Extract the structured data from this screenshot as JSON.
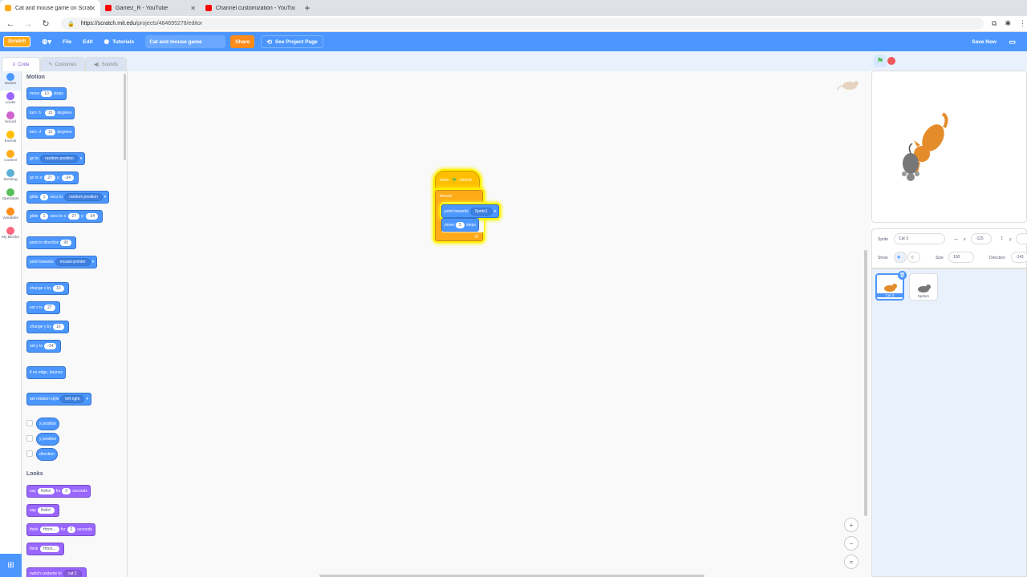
{
  "browser": {
    "tabs": [
      {
        "title": "Cat and mouse game on Scratch",
        "favicon_color": "#ffab19"
      },
      {
        "title": "Gamez_R - YouTube",
        "favicon_color": "#ff0000"
      },
      {
        "title": "Channel customization - YouTub",
        "favicon_color": "#ff0000"
      }
    ],
    "url_host": "https://scratch.mit.edu",
    "url_path": "/projects/484695278/editor"
  },
  "menu": {
    "logo": "Scratch",
    "file": "File",
    "edit": "Edit",
    "tutorials": "Tutorials",
    "project_title": "Cat and mouse game",
    "share": "Share",
    "see_project_page": "See Project Page",
    "save_now": "Save Now"
  },
  "editor_tabs": {
    "code": "Code",
    "costumes": "Costumes",
    "sounds": "Sounds"
  },
  "categories": [
    {
      "label": "Motion",
      "color": "#4c97ff"
    },
    {
      "label": "Looks",
      "color": "#9966ff"
    },
    {
      "label": "Sound",
      "color": "#cf63cf"
    },
    {
      "label": "Events",
      "color": "#ffbf00"
    },
    {
      "label": "Control",
      "color": "#ffab19"
    },
    {
      "label": "Sensing",
      "color": "#5cb1d6"
    },
    {
      "label": "Operators",
      "color": "#59c059"
    },
    {
      "label": "Variables",
      "color": "#ff8c1a"
    },
    {
      "label": "My Blocks",
      "color": "#ff6680"
    }
  ],
  "palette": {
    "motion_heading": "Motion",
    "looks_heading": "Looks",
    "move": {
      "a": "move",
      "v": "10",
      "b": "steps"
    },
    "turn_right": {
      "a": "turn",
      "v": "15",
      "b": "degrees"
    },
    "turn_left": {
      "a": "turn",
      "v": "15",
      "b": "degrees"
    },
    "goto": {
      "a": "go to",
      "dd": "random position"
    },
    "gotoxy": {
      "a": "go to x:",
      "x": "27",
      "b": "y:",
      "y": "-34"
    },
    "glide_to": {
      "a": "glide",
      "v": "1",
      "b": "secs to",
      "dd": "random position"
    },
    "glide_xy": {
      "a": "glide",
      "v": "1",
      "b": "secs to x:",
      "x": "27",
      "c": "y:",
      "y": "-34"
    },
    "point_dir": {
      "a": "point in direction",
      "v": "90"
    },
    "point_towards": {
      "a": "point towards",
      "dd": "mouse-pointer"
    },
    "change_x": {
      "a": "change x by",
      "v": "10"
    },
    "set_x": {
      "a": "set x to",
      "v": "27"
    },
    "change_y": {
      "a": "change y by",
      "v": "10"
    },
    "set_y": {
      "a": "set y to",
      "v": "-34"
    },
    "bounce": "if on edge, bounce",
    "rotation": {
      "a": "set rotation style",
      "dd": "left-right"
    },
    "x_position": "x position",
    "y_position": "y position",
    "direction": "direction",
    "say_for": {
      "a": "say",
      "v": "Hello!",
      "b": "for",
      "n": "2",
      "c": "seconds"
    },
    "say": {
      "a": "say",
      "v": "Hello!"
    },
    "think_for": {
      "a": "think",
      "v": "Hmm...",
      "b": "for",
      "n": "2",
      "c": "seconds"
    },
    "think": {
      "a": "think",
      "v": "Hmm..."
    },
    "switch_costume": {
      "a": "switch costume to",
      "dd": "cat 2"
    }
  },
  "script": {
    "hat_a": "when",
    "hat_b": "clicked",
    "forever": "forever",
    "point_towards": "point towards",
    "point_target": "Sprite1",
    "move": "move",
    "move_steps": "5",
    "steps": "steps"
  },
  "sprite_info": {
    "sprite_label": "Sprite",
    "sprite_name": "Cat 3",
    "x_label": "x",
    "x_value": "-115",
    "y_label": "y",
    "show_label": "Show",
    "size_label": "Size",
    "size_value": "100",
    "direction_label": "Direction",
    "direction_value": "-141"
  },
  "sprites": [
    {
      "name": "Cat 3",
      "selected": true
    },
    {
      "name": "Sprite1",
      "selected": false
    }
  ]
}
